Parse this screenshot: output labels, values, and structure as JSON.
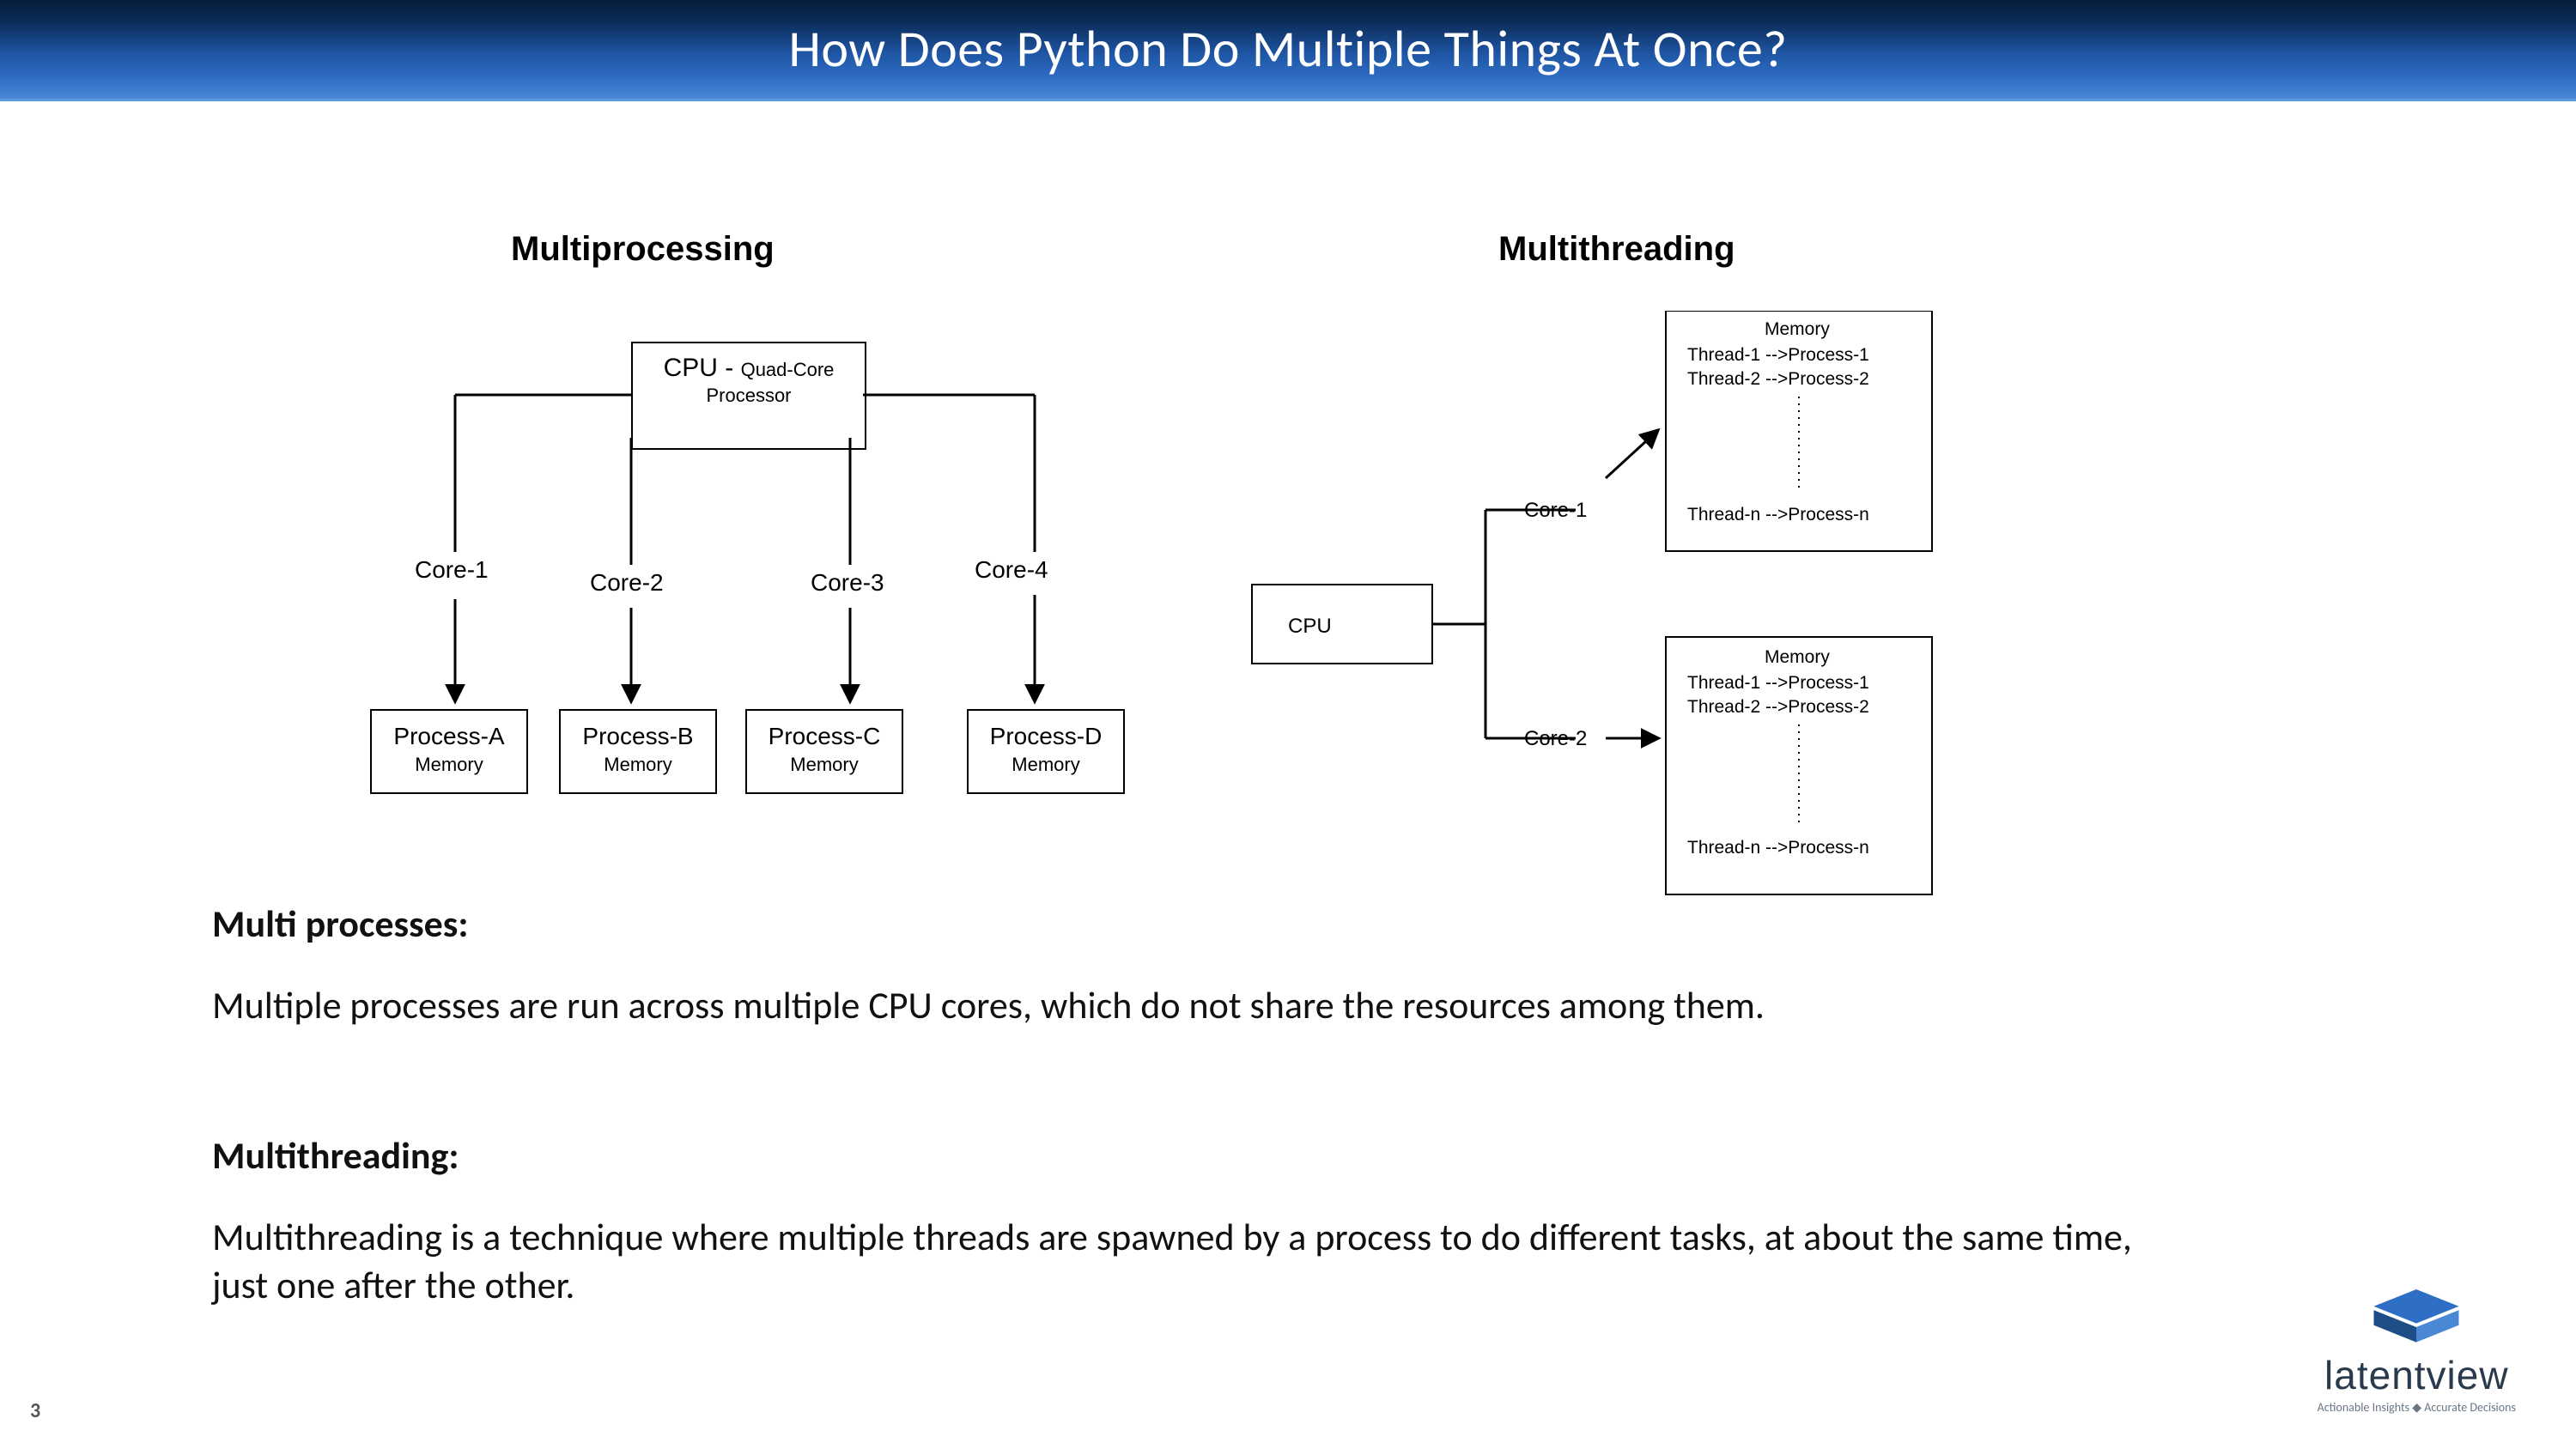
{
  "header": {
    "title": "How Does Python Do Multiple Things At Once?"
  },
  "mp": {
    "title": "Multiprocessing",
    "cpu_l1a": "CPU - ",
    "cpu_l1b": "Quad-Core",
    "cpu_l2": "Processor",
    "cores": [
      "Core-1",
      "Core-2",
      "Core-3",
      "Core-4"
    ],
    "procs": [
      "Process-A",
      "Process-B",
      "Process-C",
      "Process-D"
    ],
    "mem": "Memory"
  },
  "mt": {
    "title": "Multithreading",
    "cpu": "CPU",
    "cores": [
      "Core-1",
      "Core-2"
    ],
    "mem": "Memory",
    "t1": "Thread-1 -->Process-1",
    "t2": "Thread-2 -->Process-2",
    "tn": "Thread-n -->Process-n"
  },
  "text": {
    "h1": "Multi processes:",
    "p1": "Multiple processes are run across multiple CPU cores, which do not share the resources among them.",
    "h2": "Multithreading:",
    "p2": "Multithreading is a technique where multiple threads are spawned by a process to do different tasks, at about the same time, just one after the other."
  },
  "page": "3",
  "logo": {
    "word": "latentview",
    "tag": "Actionable Insights ◆ Accurate Decisions"
  }
}
